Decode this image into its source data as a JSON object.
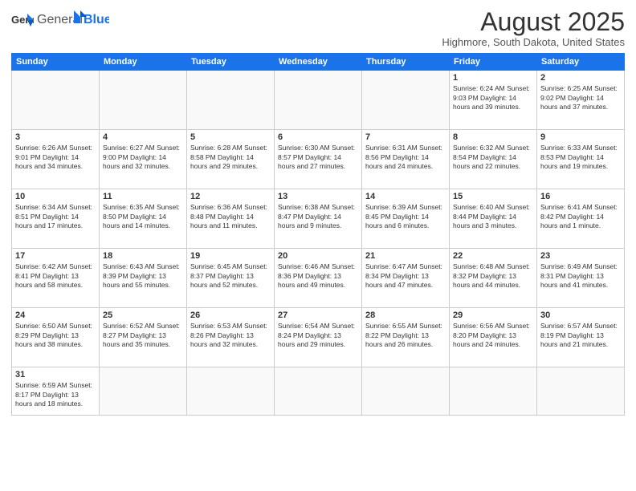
{
  "header": {
    "logo_general": "General",
    "logo_blue": "Blue",
    "month": "August 2025",
    "location": "Highmore, South Dakota, United States"
  },
  "days_of_week": [
    "Sunday",
    "Monday",
    "Tuesday",
    "Wednesday",
    "Thursday",
    "Friday",
    "Saturday"
  ],
  "weeks": [
    [
      {
        "day": "",
        "info": ""
      },
      {
        "day": "",
        "info": ""
      },
      {
        "day": "",
        "info": ""
      },
      {
        "day": "",
        "info": ""
      },
      {
        "day": "",
        "info": ""
      },
      {
        "day": "1",
        "info": "Sunrise: 6:24 AM\nSunset: 9:03 PM\nDaylight: 14 hours and 39 minutes."
      },
      {
        "day": "2",
        "info": "Sunrise: 6:25 AM\nSunset: 9:02 PM\nDaylight: 14 hours and 37 minutes."
      }
    ],
    [
      {
        "day": "3",
        "info": "Sunrise: 6:26 AM\nSunset: 9:01 PM\nDaylight: 14 hours and 34 minutes."
      },
      {
        "day": "4",
        "info": "Sunrise: 6:27 AM\nSunset: 9:00 PM\nDaylight: 14 hours and 32 minutes."
      },
      {
        "day": "5",
        "info": "Sunrise: 6:28 AM\nSunset: 8:58 PM\nDaylight: 14 hours and 29 minutes."
      },
      {
        "day": "6",
        "info": "Sunrise: 6:30 AM\nSunset: 8:57 PM\nDaylight: 14 hours and 27 minutes."
      },
      {
        "day": "7",
        "info": "Sunrise: 6:31 AM\nSunset: 8:56 PM\nDaylight: 14 hours and 24 minutes."
      },
      {
        "day": "8",
        "info": "Sunrise: 6:32 AM\nSunset: 8:54 PM\nDaylight: 14 hours and 22 minutes."
      },
      {
        "day": "9",
        "info": "Sunrise: 6:33 AM\nSunset: 8:53 PM\nDaylight: 14 hours and 19 minutes."
      }
    ],
    [
      {
        "day": "10",
        "info": "Sunrise: 6:34 AM\nSunset: 8:51 PM\nDaylight: 14 hours and 17 minutes."
      },
      {
        "day": "11",
        "info": "Sunrise: 6:35 AM\nSunset: 8:50 PM\nDaylight: 14 hours and 14 minutes."
      },
      {
        "day": "12",
        "info": "Sunrise: 6:36 AM\nSunset: 8:48 PM\nDaylight: 14 hours and 11 minutes."
      },
      {
        "day": "13",
        "info": "Sunrise: 6:38 AM\nSunset: 8:47 PM\nDaylight: 14 hours and 9 minutes."
      },
      {
        "day": "14",
        "info": "Sunrise: 6:39 AM\nSunset: 8:45 PM\nDaylight: 14 hours and 6 minutes."
      },
      {
        "day": "15",
        "info": "Sunrise: 6:40 AM\nSunset: 8:44 PM\nDaylight: 14 hours and 3 minutes."
      },
      {
        "day": "16",
        "info": "Sunrise: 6:41 AM\nSunset: 8:42 PM\nDaylight: 14 hours and 1 minute."
      }
    ],
    [
      {
        "day": "17",
        "info": "Sunrise: 6:42 AM\nSunset: 8:41 PM\nDaylight: 13 hours and 58 minutes."
      },
      {
        "day": "18",
        "info": "Sunrise: 6:43 AM\nSunset: 8:39 PM\nDaylight: 13 hours and 55 minutes."
      },
      {
        "day": "19",
        "info": "Sunrise: 6:45 AM\nSunset: 8:37 PM\nDaylight: 13 hours and 52 minutes."
      },
      {
        "day": "20",
        "info": "Sunrise: 6:46 AM\nSunset: 8:36 PM\nDaylight: 13 hours and 49 minutes."
      },
      {
        "day": "21",
        "info": "Sunrise: 6:47 AM\nSunset: 8:34 PM\nDaylight: 13 hours and 47 minutes."
      },
      {
        "day": "22",
        "info": "Sunrise: 6:48 AM\nSunset: 8:32 PM\nDaylight: 13 hours and 44 minutes."
      },
      {
        "day": "23",
        "info": "Sunrise: 6:49 AM\nSunset: 8:31 PM\nDaylight: 13 hours and 41 minutes."
      }
    ],
    [
      {
        "day": "24",
        "info": "Sunrise: 6:50 AM\nSunset: 8:29 PM\nDaylight: 13 hours and 38 minutes."
      },
      {
        "day": "25",
        "info": "Sunrise: 6:52 AM\nSunset: 8:27 PM\nDaylight: 13 hours and 35 minutes."
      },
      {
        "day": "26",
        "info": "Sunrise: 6:53 AM\nSunset: 8:26 PM\nDaylight: 13 hours and 32 minutes."
      },
      {
        "day": "27",
        "info": "Sunrise: 6:54 AM\nSunset: 8:24 PM\nDaylight: 13 hours and 29 minutes."
      },
      {
        "day": "28",
        "info": "Sunrise: 6:55 AM\nSunset: 8:22 PM\nDaylight: 13 hours and 26 minutes."
      },
      {
        "day": "29",
        "info": "Sunrise: 6:56 AM\nSunset: 8:20 PM\nDaylight: 13 hours and 24 minutes."
      },
      {
        "day": "30",
        "info": "Sunrise: 6:57 AM\nSunset: 8:19 PM\nDaylight: 13 hours and 21 minutes."
      }
    ],
    [
      {
        "day": "31",
        "info": "Sunrise: 6:59 AM\nSunset: 8:17 PM\nDaylight: 13 hours and 18 minutes."
      },
      {
        "day": "",
        "info": ""
      },
      {
        "day": "",
        "info": ""
      },
      {
        "day": "",
        "info": ""
      },
      {
        "day": "",
        "info": ""
      },
      {
        "day": "",
        "info": ""
      },
      {
        "day": "",
        "info": ""
      }
    ]
  ]
}
